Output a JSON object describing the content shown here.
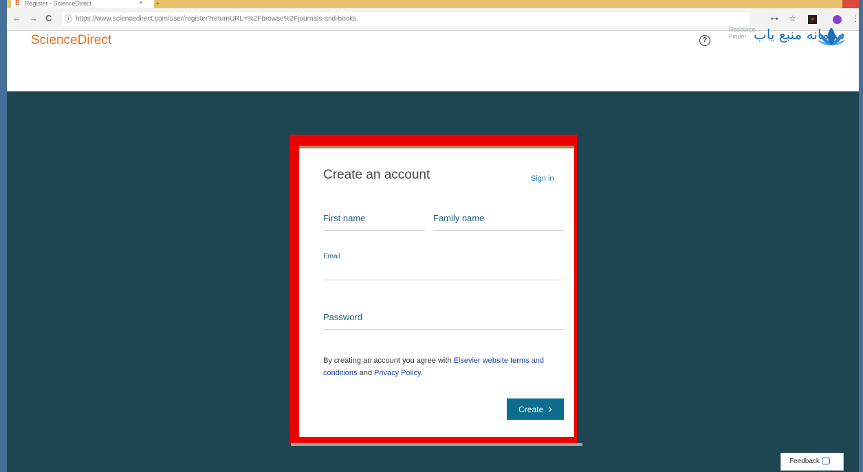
{
  "browser": {
    "tab_title": "Register - ScienceDirect",
    "tab_favicon": "E",
    "tab_close": "×",
    "new_tab": "+",
    "back": "←",
    "forward": "→",
    "reload": "C",
    "info_icon": "ⓘ",
    "url": "https://www.sciencedirect.com/user/register?returnURL=%2Fbrowse%2Fjournals-and-books",
    "key_icon": "⊶",
    "star_icon": "☆",
    "menu_icon": "⋮"
  },
  "header": {
    "logo_text": "ScienceDirect",
    "help_icon": "?",
    "rf_small_1": "Resource",
    "rf_small_2": "Finder",
    "rf_farsi": "سامانه منبع یاب"
  },
  "form": {
    "title": "Create an account",
    "sign_in": "Sign in",
    "first_name": "First name",
    "family_name": "Family name",
    "email": "Email",
    "password": "Password",
    "terms_pre": "By creating an account you agree with ",
    "terms_link": "Elsevier website terms and conditions",
    "terms_mid": " and ",
    "privacy_link": "Privacy Policy",
    "terms_post": ".",
    "create_button": "Create",
    "create_chevron": "›"
  },
  "feedback": {
    "label": "Feedback"
  },
  "colors": {
    "accent_orange": "#e9711c",
    "button_teal": "#0c6e8e",
    "page_background": "#1e4652",
    "highlight_red": "#ee0000"
  }
}
